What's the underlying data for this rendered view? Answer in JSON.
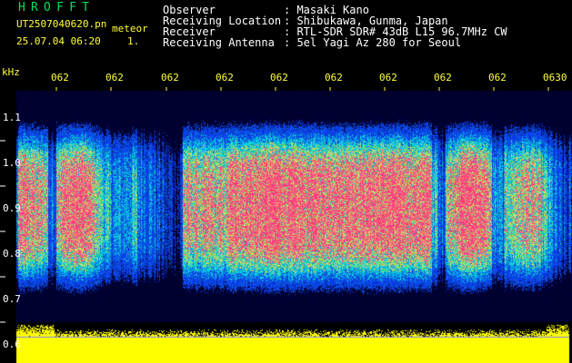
{
  "header": {
    "logo": "HROFFT",
    "filename": "UT2507040620.pn",
    "mode_label": "meteor",
    "datetime": "25.07.04 06:20",
    "sequence": "1.",
    "info": [
      {
        "label": "Observer",
        "value": ": Masaki Kano"
      },
      {
        "label": "Receiving Location",
        "value": ": Shibukawa, Gunma, Japan"
      },
      {
        "label": "Receiver",
        "value": ": RTL-SDR SDR# 43dB L15 96.7MHz CW"
      },
      {
        "label": "Receiving Antenna",
        "value": ": 5el Yagi Az 280 for Seoul"
      }
    ]
  },
  "axis": {
    "unit_label": "kHz",
    "y_ticks": [
      "1.1",
      "1.0",
      "0.9",
      "0.8",
      "0.7",
      "0.6"
    ],
    "x_ticks": [
      "062",
      "062",
      "062",
      "062",
      "062",
      "062",
      "062",
      "062",
      "062",
      "0630"
    ]
  },
  "colors": {
    "background": "#000000",
    "header_text": "#ffffff",
    "logo": "#00e060",
    "axis_labels": "#ffff3c",
    "signal_strong": "#ff3070",
    "signal_mid": "#30e060",
    "signal_weak": "#1040ff",
    "level_bar": "#ffff00"
  }
}
